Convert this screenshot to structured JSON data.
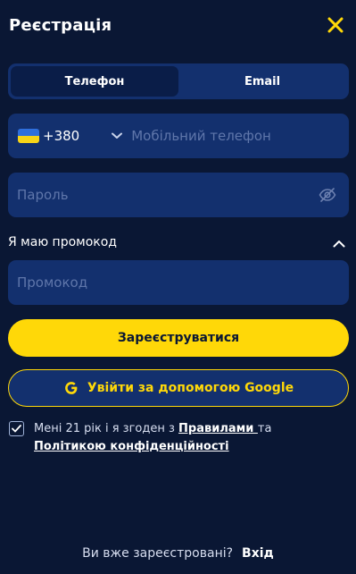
{
  "header": {
    "title": "Реєстрація"
  },
  "tabs": [
    {
      "label": "Телефон",
      "active": true
    },
    {
      "label": "Email",
      "active": false
    }
  ],
  "phone": {
    "country_code": "+380",
    "placeholder": "Мобільний телефон"
  },
  "password": {
    "placeholder": "Пароль"
  },
  "promo": {
    "toggle_label": "Я маю промокод",
    "placeholder": "Промокод"
  },
  "buttons": {
    "register": "Зареєструватися",
    "google": "Увійти за допомогою Google"
  },
  "agreement": {
    "text_before": "Мені 21 рік і я згоден з ",
    "rules_link": "Правилами ",
    "text_mid": "та ",
    "privacy_link": "Політикою конфіденційності",
    "checked": true
  },
  "footer": {
    "question": "Ви вже зареєстровані?",
    "login": "Вхід"
  },
  "colors": {
    "background": "#0a1734",
    "field": "#13306e",
    "accent": "#ffd808"
  }
}
